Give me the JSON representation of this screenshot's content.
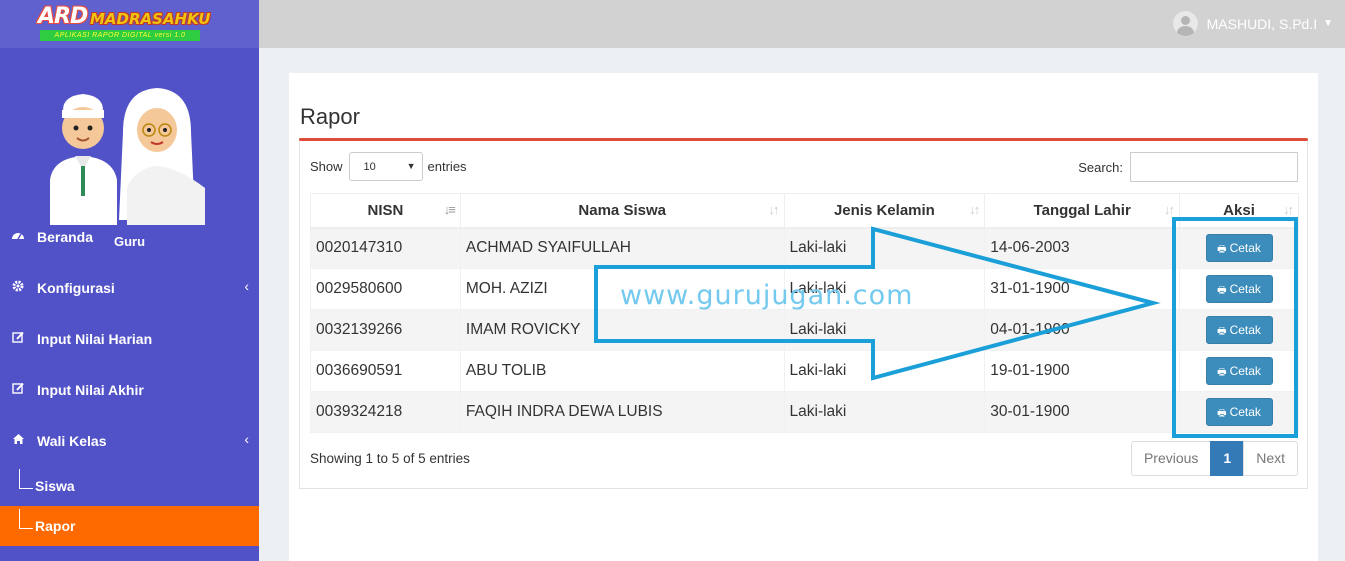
{
  "app": {
    "logo_main": "ARD",
    "logo_brand": "MADRASAHKU",
    "logo_tagline": "APLIKASI RAPOR DIGITAL versi 1.0"
  },
  "sidebar": {
    "user_role": "Guru",
    "items": [
      {
        "label": "Beranda",
        "icon": "dashboard-icon"
      },
      {
        "label": "Konfigurasi",
        "icon": "gear-icon"
      },
      {
        "label": "Input Nilai Harian",
        "icon": "edit-icon"
      },
      {
        "label": "Input Nilai Akhir",
        "icon": "edit-icon"
      },
      {
        "label": "Wali Kelas",
        "icon": "home-icon"
      }
    ],
    "sub_items": [
      {
        "label": "Siswa"
      },
      {
        "label": "Rapor"
      }
    ]
  },
  "header": {
    "user_name": "MASHUDI, S.Pd.I"
  },
  "main": {
    "title": "Rapor",
    "show_label": "Show",
    "entries_value": "10",
    "entries_label": "entries",
    "search_label": "Search:",
    "columns": [
      "NISN",
      "Nama Siswa",
      "Jenis Kelamin",
      "Tanggal Lahir",
      "Aksi"
    ],
    "rows": [
      {
        "nisn": "0020147310",
        "nama": "ACHMAD SYAIFULLAH",
        "jk": "Laki-laki",
        "tgl": "14-06-2003",
        "aksi": "Cetak"
      },
      {
        "nisn": "0029580600",
        "nama": "MOH. AZIZI",
        "jk": "Laki-laki",
        "tgl": "31-01-1900",
        "aksi": "Cetak"
      },
      {
        "nisn": "0032139266",
        "nama": "IMAM ROVICKY",
        "jk": "Laki-laki",
        "tgl": "04-01-1900",
        "aksi": "Cetak"
      },
      {
        "nisn": "0036690591",
        "nama": "ABU TOLIB",
        "jk": "Laki-laki",
        "tgl": "19-01-1900",
        "aksi": "Cetak"
      },
      {
        "nisn": "0039324218",
        "nama": "FAQIH INDRA DEWA LUBIS",
        "jk": "Laki-laki",
        "tgl": "30-01-1900",
        "aksi": "Cetak"
      }
    ],
    "info": "Showing 1 to 5 of 5 entries",
    "pagination": {
      "previous": "Previous",
      "current": "1",
      "next": "Next"
    }
  },
  "overlay": {
    "watermark": "www.gurujugan.com"
  },
  "colors": {
    "sidebar": "#5252c8",
    "active": "#ff6a00",
    "primary": "#3c8dbc",
    "title_line": "#dd4b39",
    "annotation": "#1a9fd8"
  }
}
